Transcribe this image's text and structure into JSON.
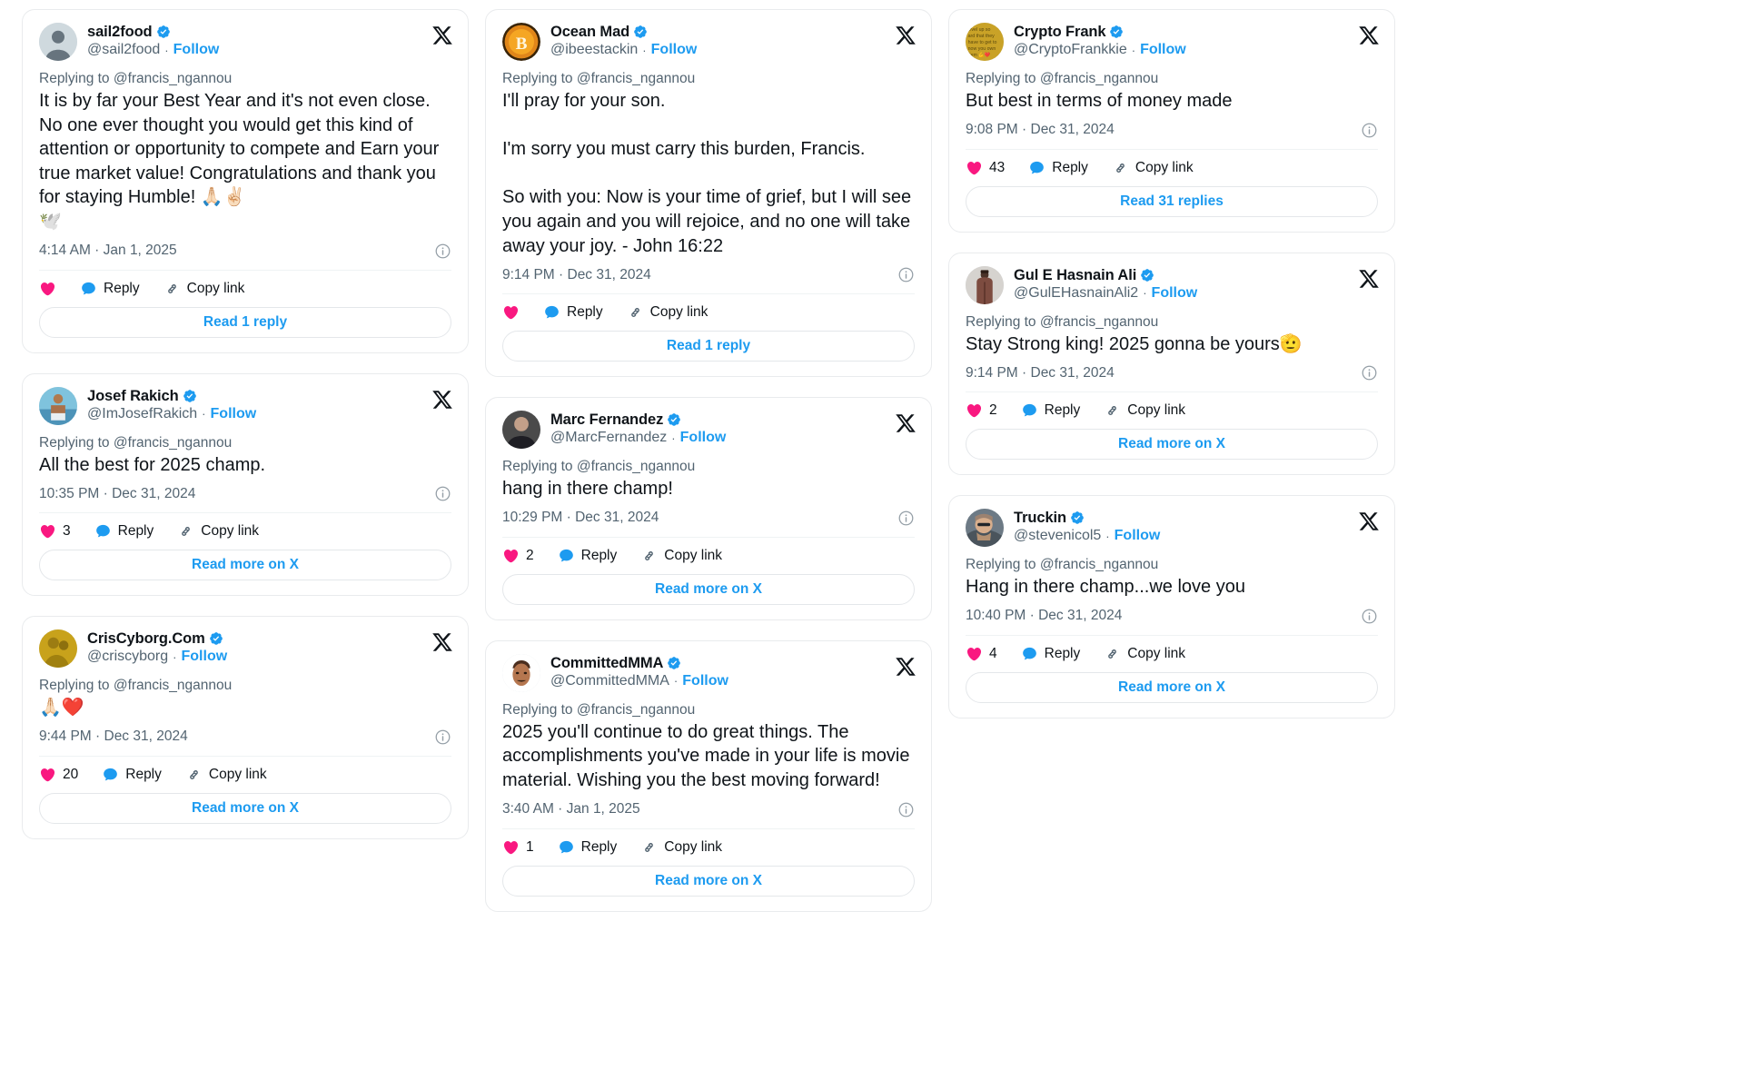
{
  "meta": {
    "replying_prefix": "Replying to",
    "reply_target": "@francis_ngannou",
    "follow_label": "Follow",
    "separator": "·",
    "reply_label": "Reply",
    "copy_link_label": "Copy link",
    "accent_blue": "#1d9bf0",
    "heart_pink": "#f91880",
    "text_primary": "#0f1419",
    "text_secondary": "#536471",
    "card_border": "#e9ebed"
  },
  "columns": [
    {
      "id": "column-left",
      "tweets": [
        {
          "id": "tweet-sail2food",
          "display_name": "sail2food",
          "handle": "@sail2food",
          "verified": true,
          "avatar_type": "default-person",
          "avatar_color": "#cfd9de",
          "replying_to": "@francis_ngannou",
          "text": "It is by far your Best Year and it's not even close. No one ever thought you would get this kind of attention or opportunity to compete and Earn your true market value! Congratulations and thank you for staying Humble! 🙏🏻✌🏻\n🕊️",
          "timestamp": "4:14 AM · Jan 1, 2025",
          "like_count": "",
          "footer_label": "Read 1 reply",
          "has_footer": true
        },
        {
          "id": "tweet-josef-rakich",
          "display_name": "Josef Rakich",
          "handle": "@ImJosefRakich",
          "verified": true,
          "avatar_type": "photo-beach",
          "avatar_color": "#5a9fc4",
          "replying_to": "@francis_ngannou",
          "text": "All the best for 2025 champ.",
          "timestamp": "10:35 PM · Dec 31, 2024",
          "like_count": "3",
          "footer_label": "Read more on X",
          "has_footer": true
        },
        {
          "id": "tweet-criscyborg",
          "display_name": "CrisCyborg.Com",
          "handle": "@criscyborg",
          "verified": true,
          "avatar_type": "photo-gold",
          "avatar_color": "#c8a21b",
          "replying_to": "@francis_ngannou",
          "text": "🙏🏻❤️",
          "timestamp": "9:44 PM · Dec 31, 2024",
          "like_count": "20",
          "footer_label": "Read more on X",
          "has_footer": true
        }
      ]
    },
    {
      "id": "column-middle",
      "tweets": [
        {
          "id": "tweet-ocean-mad",
          "display_name": "Ocean Mad",
          "handle": "@ibeestackin",
          "verified": true,
          "avatar_type": "bitcoin",
          "avatar_color": "#f2a33c",
          "replying_to": "@francis_ngannou",
          "text": "I'll pray for your son.\n\nI'm sorry you must carry this burden, Francis.\n\nSo with you: Now is your time of grief, but I will see you again and you will rejoice, and no one will take away your joy. - John 16:22",
          "timestamp": "9:14 PM · Dec 31, 2024",
          "like_count": "",
          "footer_label": "Read 1 reply",
          "has_footer": true
        },
        {
          "id": "tweet-marc-fernandez",
          "display_name": "Marc Fernandez",
          "handle": "@MarcFernandez",
          "verified": true,
          "avatar_type": "photo-dark",
          "avatar_color": "#3a3a3a",
          "replying_to": "@francis_ngannou",
          "text": "hang in there champ!",
          "timestamp": "10:29 PM · Dec 31, 2024",
          "like_count": "2",
          "footer_label": "Read more on X",
          "has_footer": true
        },
        {
          "id": "tweet-committedmma",
          "display_name": "CommittedMMA",
          "handle": "@CommittedMMA",
          "verified": true,
          "avatar_type": "cartoon-face",
          "avatar_color": "#ffffff",
          "replying_to": "@francis_ngannou",
          "text": "2025 you'll continue to do great things. The accomplishments you've made in your life is movie material. Wishing you the best moving forward!",
          "timestamp": "3:40 AM · Jan 1, 2025",
          "like_count": "1",
          "footer_label": "Read more on X",
          "has_footer": true
        }
      ]
    },
    {
      "id": "column-right",
      "tweets": [
        {
          "id": "tweet-crypto-frank",
          "display_name": "Crypto Frank",
          "handle": "@CryptoFrankkie",
          "verified": true,
          "avatar_type": "text-gold",
          "avatar_color": "#c9a227",
          "replying_to": "@francis_ngannou",
          "text": "But best in terms of money made",
          "timestamp": "9:08 PM · Dec 31, 2024",
          "like_count": "43",
          "footer_label": "Read 31 replies",
          "has_footer": true
        },
        {
          "id": "tweet-gul-e-hasnain-ali",
          "display_name": "Gul E Hasnain Ali",
          "handle": "@GulEHasnainAli2",
          "verified": true,
          "avatar_type": "photo-person",
          "avatar_color": "#8a6a5c",
          "replying_to": "@francis_ngannou",
          "text": "Stay Strong king! 2025 gonna be yours🫡",
          "timestamp": "9:14 PM · Dec 31, 2024",
          "like_count": "2",
          "footer_label": "Read more on X",
          "has_footer": true
        },
        {
          "id": "tweet-truckin",
          "display_name": "Truckin",
          "handle": "@stevenicol5",
          "verified": true,
          "avatar_type": "photo-sunglasses",
          "avatar_color": "#7a7f86",
          "replying_to": "@francis_ngannou",
          "text": "Hang in there champ...we love you",
          "timestamp": "10:40 PM · Dec 31, 2024",
          "like_count": "4",
          "footer_label": "Read more on X",
          "has_footer": true
        }
      ]
    }
  ]
}
